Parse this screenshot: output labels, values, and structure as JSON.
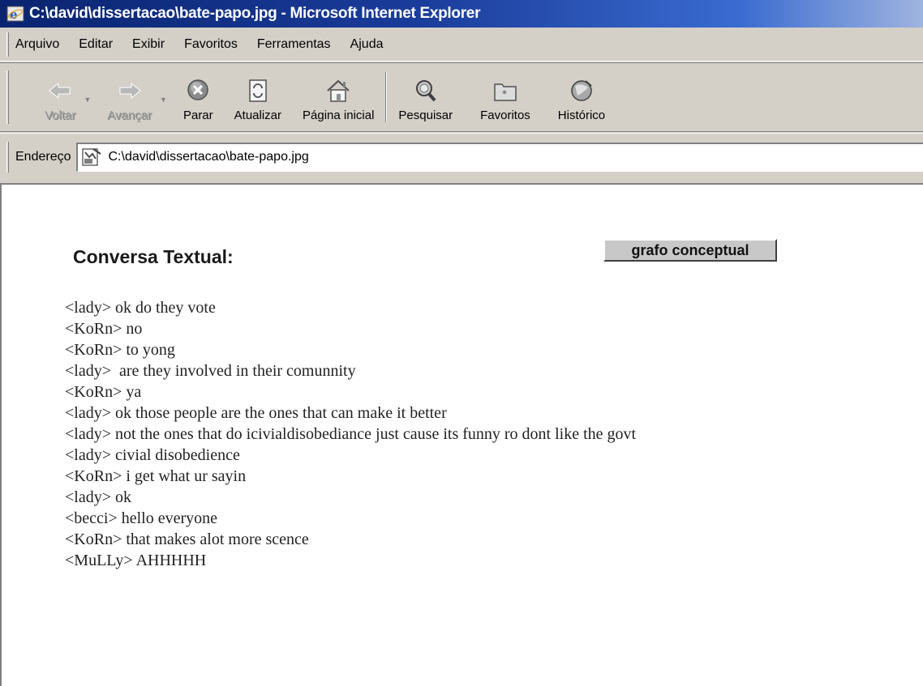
{
  "window": {
    "title": "C:\\david\\dissertacao\\bate-papo.jpg - Microsoft Internet Explorer"
  },
  "menu": {
    "items": [
      "Arquivo",
      "Editar",
      "Exibir",
      "Favoritos",
      "Ferramentas",
      "Ajuda"
    ]
  },
  "toolbar": {
    "back": "Voltar",
    "forward": "Avançar",
    "stop": "Parar",
    "refresh": "Atualizar",
    "home": "Página inicial",
    "search": "Pesquisar",
    "favorites": "Favoritos",
    "history": "Histórico"
  },
  "address": {
    "label": "Endereço",
    "value": "C:\\david\\dissertacao\\bate-papo.jpg"
  },
  "page": {
    "heading": "Conversa Textual:",
    "graph_button": "grafo conceptual",
    "chat_lines": [
      "<lady> ok do they vote",
      "<KoRn> no",
      "<KoRn> to yong",
      "<lady>  are they involved in their comunnity",
      "<KoRn> ya",
      "<lady> ok those people are the ones that can make it better",
      "<lady> not the ones that do icivialdisobediance just cause its funny ro dont  like the govt",
      "<lady> civial disobedience",
      "<KoRn> i get what ur sayin",
      "<lady> ok",
      "<becci> hello everyone",
      "<KoRn> that makes alot more scence",
      "<MuLLy> AHHHHH"
    ]
  },
  "colors": {
    "titlebar_start": "#0a2470",
    "chrome": "#d4d0c8"
  },
  "icons": [
    "ie-icon",
    "back-arrow-icon",
    "forward-arrow-icon",
    "stop-icon",
    "refresh-icon",
    "home-icon",
    "search-icon",
    "favorites-icon",
    "history-icon",
    "jpg-file-icon"
  ]
}
